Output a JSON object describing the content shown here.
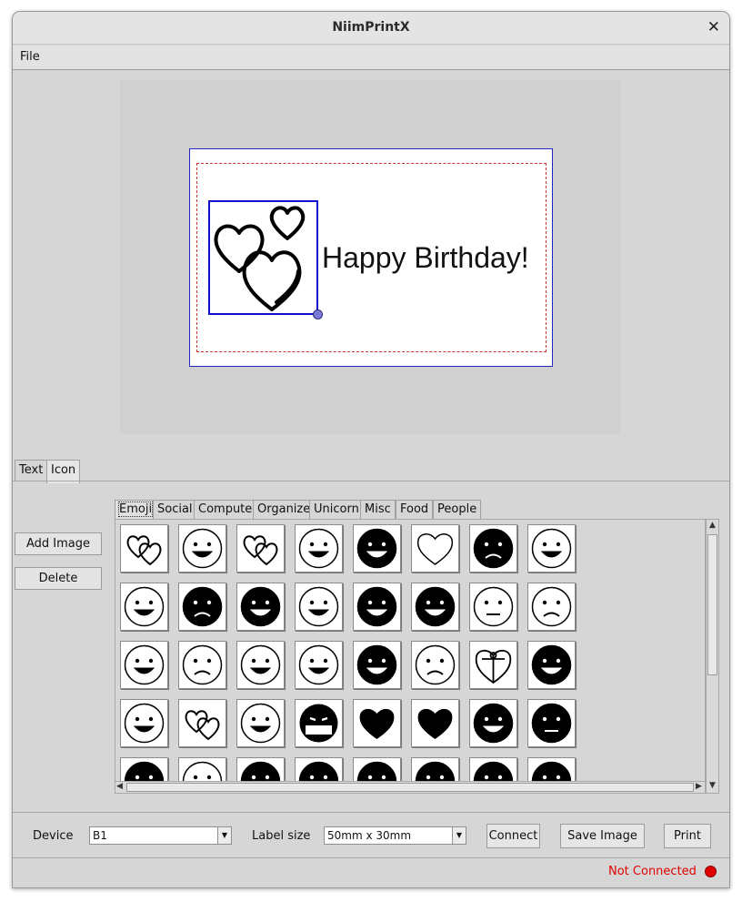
{
  "window": {
    "title": "NiimPrintX"
  },
  "menu": {
    "file": "File"
  },
  "label": {
    "text": "Happy Birthday!"
  },
  "tabs": [
    "Text",
    "Icon"
  ],
  "side_buttons": {
    "add_image": "Add Image",
    "delete": "Delete"
  },
  "categories": [
    "Emoji",
    "Social",
    "Computer",
    "Organize",
    "Unicorn",
    "Misc",
    "Food",
    "People"
  ],
  "icons": [
    [
      "hearts-icon",
      "thinking-face-icon",
      "two-hearts-icon",
      "smiling-devil-icon",
      "sunglasses-face-icon",
      "heart-outline-icon",
      "angry-face-icon",
      "grinning-squint-icon"
    ],
    [
      "savoring-face-icon",
      "frowning-face-icon",
      "dizzy-face-icon",
      "joy-face-icon",
      "laughing-face-icon",
      "sweat-smile-icon",
      "squint-face-icon",
      "bandaged-face-icon"
    ],
    [
      "grin-squint-icon",
      "angry-face-outline-icon",
      "yawning-face-icon",
      "star-struck-face-icon",
      "nerd-face-icon",
      "confused-face-icon",
      "gift-heart-icon",
      "drooling-face-icon"
    ],
    [
      "rolling-laugh-icon",
      "heart-eyes-face-icon",
      "glasses-face-icon",
      "cursing-face-icon",
      "heart-solid-icon",
      "heart-solid-shine-icon",
      "tears-of-joy-face-icon",
      "expressionless-face-icon"
    ],
    [
      "sweat-face-partial-icon",
      "smile-face-partial-icon",
      "dizzy-face-partial-icon",
      "grin-face-partial-icon",
      "neutral-face-partial-icon",
      "squint-face-partial-icon",
      "persevere-face-partial-icon",
      "laugh-face-partial-icon"
    ]
  ],
  "toolbar": {
    "device_label": "Device",
    "device_value": "B1",
    "label_size_label": "Label size",
    "label_size_value": "50mm x 30mm",
    "connect": "Connect",
    "save_image": "Save Image",
    "print": "Print"
  },
  "status": {
    "text": "Not Connected",
    "color": "#e00000"
  }
}
